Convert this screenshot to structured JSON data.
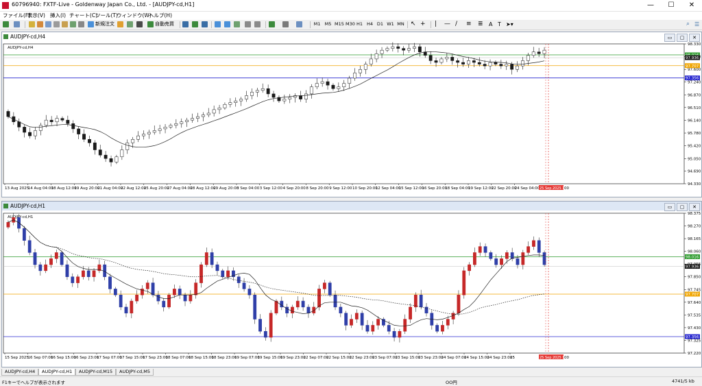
{
  "window": {
    "title": "60796940: FXTF-Live - Goldenway Japan Co., Ltd. - [AUDJPY-cd,H1]"
  },
  "menu": [
    "ファイル(F)",
    "表示(V)",
    "挿入(I)",
    "チャート(C)",
    "ツール(T)",
    "ウィンドウ(W)",
    "ヘルプ(H)"
  ],
  "toolbar": {
    "new_order": "新規注文",
    "auto_trade": "自動売買",
    "timeframes": [
      "M1",
      "M5",
      "M15",
      "M30",
      "H1",
      "H4",
      "D1",
      "W1",
      "MN"
    ]
  },
  "chart_h4": {
    "title": "AUDJPY-cd,H4",
    "label": "AUDJPY-cd,H4",
    "price_levels": [
      "98.330",
      "97.970",
      "97.600",
      "97.240",
      "96.870",
      "96.510",
      "96.140",
      "95.780",
      "95.420",
      "95.050",
      "94.690",
      "94.330"
    ],
    "marker_labels": {
      "green": "98.016",
      "current": "97.936",
      "orange": "97.707",
      "blue": "97.356"
    },
    "time_labels": [
      "13 Aug 2025",
      "14 Aug 04:00",
      "18 Aug 12:00",
      "19 Aug 20:00",
      "21 Aug 04:00",
      "22 Aug 12:00",
      "25 Aug 20:00",
      "27 Aug 04:00",
      "28 Aug 12:00",
      "29 Aug 20:00",
      "3 Sep 04:00",
      "3 Sep 12:00",
      "4 Sep 20:00",
      "8 Sep 20:00",
      "9 Sep 12:00",
      "10 Sep 20:00",
      "12 Sep 04:00",
      "15 Sep 12:00",
      "16 Sep 20:00",
      "18 Sep 04:00",
      "19 Sep 12:00",
      "22 Sep 20:00",
      "24 Sep 04:00"
    ],
    "cursor_time": "25 Sep 2025 16:00",
    "cursor_tail": "00",
    "colors": {
      "green": "#2e9b2e",
      "orange": "#f0a500",
      "blue": "#2828d0",
      "cursor": "#e53935"
    }
  },
  "chart_h1": {
    "title": "AUDJPY-cd,H1",
    "label": "AUDJPY-cd,H1",
    "price_levels": [
      "98.375",
      "98.270",
      "98.165",
      "98.060",
      "97.955",
      "97.850",
      "97.745",
      "97.640",
      "97.535",
      "97.430",
      "97.325",
      "97.220"
    ],
    "marker_labels": {
      "green": "98.016",
      "current": "97.936",
      "orange": "97.707",
      "blue": "97.356"
    },
    "time_labels": [
      "15 Sep 2025",
      "16 Sep 07:00",
      "16 Sep 15:00",
      "16 Sep 23:00",
      "17 Sep 07:00",
      "17 Sep 15:00",
      "17 Sep 23:00",
      "18 Sep 07:00",
      "18 Sep 15:00",
      "18 Sep 23:00",
      "19 Sep 07:00",
      "19 Sep 15:00",
      "19 Sep 23:00",
      "22 Sep 07:00",
      "22 Sep 15:00",
      "22 Sep 23:00",
      "23 Sep 07:00",
      "23 Sep 15:00",
      "23 Sep 23:00",
      "24 Sep 07:00",
      "24 Sep 15:00",
      "24 Sep 23:00",
      "25"
    ],
    "cursor_time": "25 Sep 2025 16:00",
    "cursor_tail": "00"
  },
  "chart_data": [
    {
      "type": "candlestick",
      "title": "AUDJPY-cd,H4",
      "xlabel": "",
      "ylabel": "",
      "ylim": [
        94.33,
        98.33
      ],
      "grid": false,
      "up_color": "#ffffff",
      "down_color": "#1a1a1a",
      "close": [
        96.25,
        96.1,
        95.95,
        95.8,
        95.7,
        95.85,
        96.0,
        96.15,
        96.1,
        96.2,
        96.15,
        96.05,
        95.9,
        95.75,
        95.6,
        95.5,
        95.3,
        95.15,
        95.05,
        94.95,
        95.1,
        95.3,
        95.5,
        95.6,
        95.7,
        95.75,
        95.8,
        95.85,
        95.9,
        95.95,
        96.0,
        96.05,
        96.1,
        96.15,
        96.2,
        96.25,
        96.3,
        96.35,
        96.45,
        96.5,
        96.6,
        96.65,
        96.7,
        96.75,
        96.85,
        96.95,
        97.0,
        97.05,
        96.9,
        96.8,
        96.7,
        96.75,
        96.8,
        96.85,
        96.75,
        96.9,
        97.1,
        97.2,
        97.25,
        97.15,
        97.05,
        97.1,
        97.2,
        97.35,
        97.5,
        97.6,
        97.75,
        97.9,
        98.05,
        98.15,
        98.2,
        98.25,
        98.2,
        98.15,
        98.2,
        98.25,
        98.1,
        98.0,
        97.85,
        97.8,
        97.9,
        97.95,
        97.85,
        97.8,
        97.75,
        97.85,
        97.8,
        97.75,
        97.7,
        97.8,
        97.75,
        97.7,
        97.75,
        97.6,
        97.7,
        97.85,
        98.0,
        98.1,
        98.05,
        98.15
      ],
      "indicators": {
        "moving_average": "solid",
        "horizontal_lines": [
          98.016,
          97.707,
          97.356
        ]
      }
    },
    {
      "type": "candlestick",
      "title": "AUDJPY-cd,H1",
      "xlabel": "",
      "ylabel": "",
      "ylim": [
        97.22,
        98.375
      ],
      "grid": false,
      "up_color": "#c62828",
      "down_color": "#2f3fa8",
      "close": [
        98.3,
        98.34,
        98.25,
        98.15,
        98.05,
        97.95,
        97.9,
        97.95,
        98.0,
        98.05,
        97.95,
        97.85,
        97.8,
        97.85,
        97.9,
        97.85,
        97.9,
        97.95,
        97.85,
        97.75,
        97.7,
        97.6,
        97.55,
        97.65,
        97.7,
        97.75,
        97.8,
        97.7,
        97.65,
        97.6,
        97.7,
        97.75,
        97.7,
        97.65,
        97.7,
        97.8,
        97.95,
        98.05,
        97.95,
        97.9,
        97.85,
        97.9,
        97.85,
        97.8,
        97.75,
        97.7,
        97.5,
        97.4,
        97.35,
        97.55,
        97.65,
        97.6,
        97.55,
        97.6,
        97.65,
        97.6,
        97.55,
        97.6,
        97.75,
        97.8,
        97.7,
        97.6,
        97.55,
        97.45,
        97.5,
        97.55,
        97.45,
        97.4,
        97.45,
        97.5,
        97.45,
        97.4,
        97.35,
        97.4,
        97.5,
        97.6,
        97.7,
        97.6,
        97.55,
        97.45,
        97.4,
        97.45,
        97.5,
        97.55,
        97.7,
        97.9,
        97.95,
        98.05,
        98.1,
        98.05,
        98.0,
        97.95,
        98.0,
        98.05,
        98.0,
        97.95,
        98.05,
        98.1,
        98.15,
        98.05,
        97.95
      ],
      "indicators": {
        "moving_average": "solid",
        "moving_average_2": "dotted",
        "horizontal_lines": [
          98.016,
          97.707,
          97.356
        ]
      }
    }
  ],
  "tabs": [
    "AUDJPY-cd,H4",
    "AUDJPY-cd,H1",
    "AUDJPY-cd,M15",
    "AUDJPY-cd,M5"
  ],
  "status": {
    "help": "F1キーでヘルプが表示されます",
    "profile": "OO円",
    "net": "4741/5 kb"
  }
}
